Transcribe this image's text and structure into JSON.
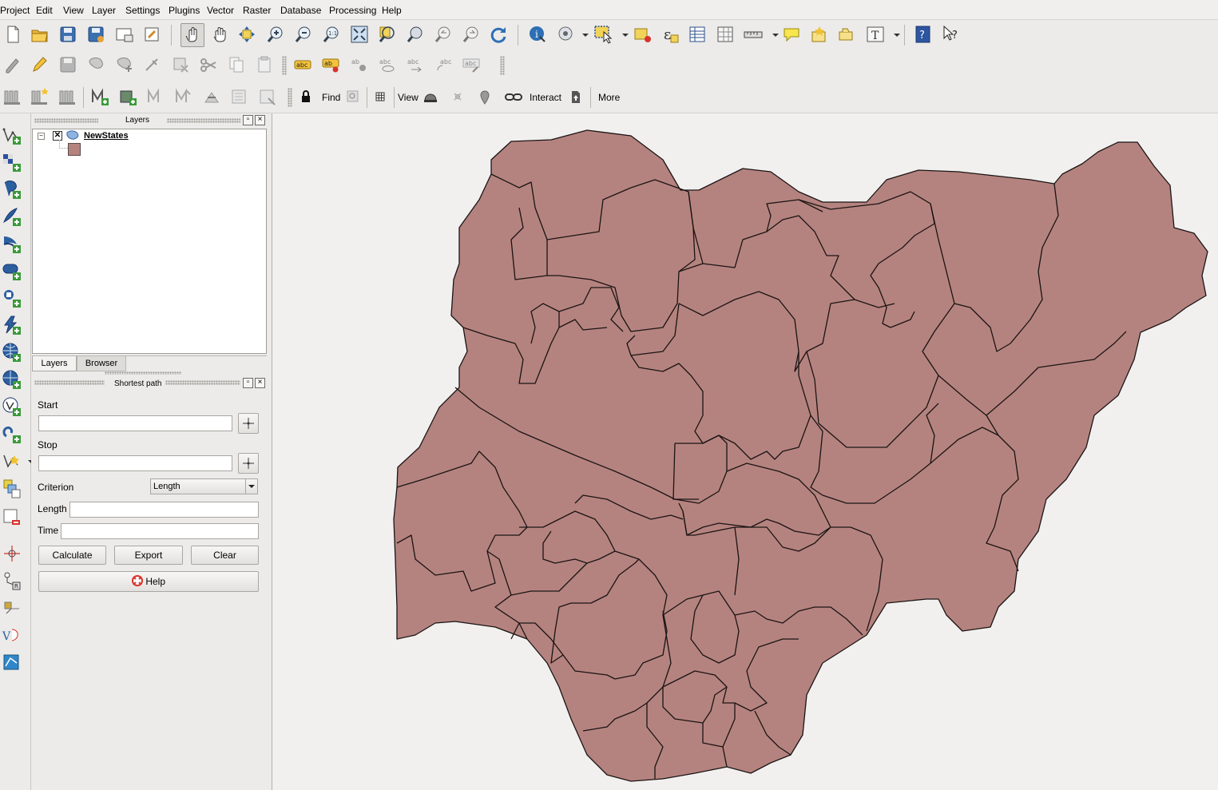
{
  "menubar": {
    "items": [
      "Project",
      "Edit",
      "View",
      "Layer",
      "Settings",
      "Plugins",
      "Vector",
      "Raster",
      "Database",
      "Processing",
      "Help"
    ]
  },
  "plugin_toolbar": {
    "find_label": "Find",
    "view_label": "View",
    "interact_label": "Interact",
    "more_label": "More"
  },
  "layers_panel": {
    "title": "Layers",
    "layer_name": "NewStates",
    "layer_fill_color": "#b5837f",
    "tabs": [
      "Layers",
      "Browser"
    ]
  },
  "shortest_path": {
    "title": "Shortest path",
    "start_label": "Start",
    "start_value": "",
    "stop_label": "Stop",
    "stop_value": "",
    "criterion_label": "Criterion",
    "criterion_value": "Length",
    "length_label": "Length",
    "length_value": "",
    "time_label": "Time",
    "time_value": "",
    "calculate_label": "Calculate",
    "export_label": "Export",
    "clear_label": "Clear",
    "help_label": "Help"
  },
  "map": {
    "fill_color": "#b5837f",
    "stroke_color": "#1a1414",
    "background_color": "#f1f0ef"
  }
}
